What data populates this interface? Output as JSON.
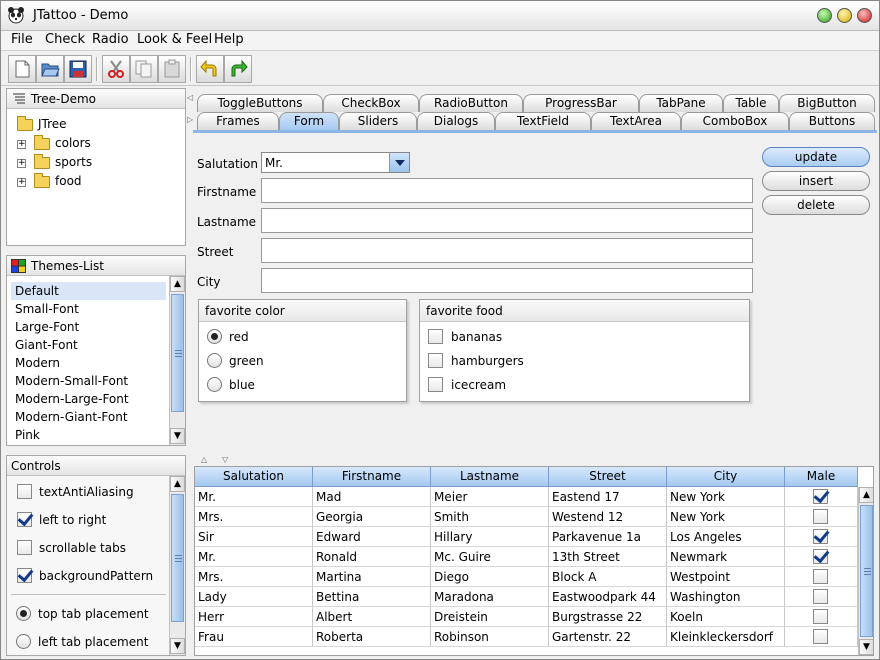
{
  "window": {
    "title": "JTattoo - Demo"
  },
  "menubar": [
    {
      "label": "File"
    },
    {
      "label": "Check"
    },
    {
      "label": "Radio"
    },
    {
      "label": "Look & Feel"
    },
    {
      "label": "Help"
    }
  ],
  "toolbar": {
    "buttons": [
      "new-icon",
      "open-icon",
      "save-icon",
      "cut-icon",
      "copy-icon",
      "paste-icon",
      "undo-icon",
      "redo-icon"
    ]
  },
  "tree": {
    "title": "Tree-Demo",
    "root": "JTree",
    "nodes": [
      "colors",
      "sports",
      "food"
    ]
  },
  "themes": {
    "title": "Themes-List",
    "items": [
      "Default",
      "Small-Font",
      "Large-Font",
      "Giant-Font",
      "Modern",
      "Modern-Small-Font",
      "Modern-Large-Font",
      "Modern-Giant-Font",
      "Pink"
    ],
    "selected": "Default"
  },
  "controls": {
    "title": "Controls",
    "checks": [
      {
        "label": "textAntiAliasing",
        "checked": false
      },
      {
        "label": "left to right",
        "checked": true
      },
      {
        "label": "scrollable tabs",
        "checked": false
      },
      {
        "label": "backgroundPattern",
        "checked": true
      }
    ],
    "radios": [
      {
        "label": "top tab placement",
        "selected": true
      },
      {
        "label": "left tab placement",
        "selected": false
      }
    ]
  },
  "tabs": {
    "row1": [
      "ToggleButtons",
      "CheckBox",
      "RadioButton",
      "ProgressBar",
      "TabPane",
      "Table",
      "BigButton"
    ],
    "row2": [
      "Frames",
      "Form",
      "Sliders",
      "Dialogs",
      "TextField",
      "TextArea",
      "ComboBox",
      "Buttons"
    ],
    "active": "Form"
  },
  "form": {
    "salutation_label": "Salutation",
    "salutation_value": "Mr.",
    "firstname_label": "Firstname",
    "lastname_label": "Lastname",
    "street_label": "Street",
    "city_label": "City",
    "buttons": {
      "update": "update",
      "insert": "insert",
      "delete": "delete"
    },
    "color_group": {
      "title": "favorite color",
      "options": [
        "red",
        "green",
        "blue"
      ],
      "selected": "red"
    },
    "food_group": {
      "title": "favorite food",
      "options": [
        "bananas",
        "hamburgers",
        "icecream"
      ]
    }
  },
  "table": {
    "columns": [
      "Salutation",
      "Firstname",
      "Lastname",
      "Street",
      "City",
      "Male"
    ],
    "rows": [
      [
        "Mr.",
        "Mad",
        "Meier",
        "Eastend 17",
        "New York",
        true
      ],
      [
        "Mrs.",
        "Georgia",
        "Smith",
        "Westend 12",
        "New York",
        false
      ],
      [
        "Sir",
        "Edward",
        "Hillary",
        "Parkavenue 1a",
        "Los Angeles",
        true
      ],
      [
        "Mr.",
        "Ronald",
        "Mc. Guire",
        "13th Street",
        "Newmark",
        true
      ],
      [
        "Mrs.",
        "Martina",
        "Diego",
        "Block A",
        "Westpoint",
        false
      ],
      [
        "Lady",
        "Bettina",
        "Maradona",
        "Eastwoodpark 44",
        "Washington",
        false
      ],
      [
        "Herr",
        "Albert",
        "Dreistein",
        "Burgstrasse 22",
        "Koeln",
        false
      ],
      [
        "Frau",
        "Roberta",
        "Robinson",
        "Gartenstr. 22",
        "Kleinkleckersdorf",
        false
      ]
    ]
  },
  "colors": {
    "accent": "#a6c9f0",
    "selection": "#d8e6f8",
    "check": "#123a8c"
  }
}
